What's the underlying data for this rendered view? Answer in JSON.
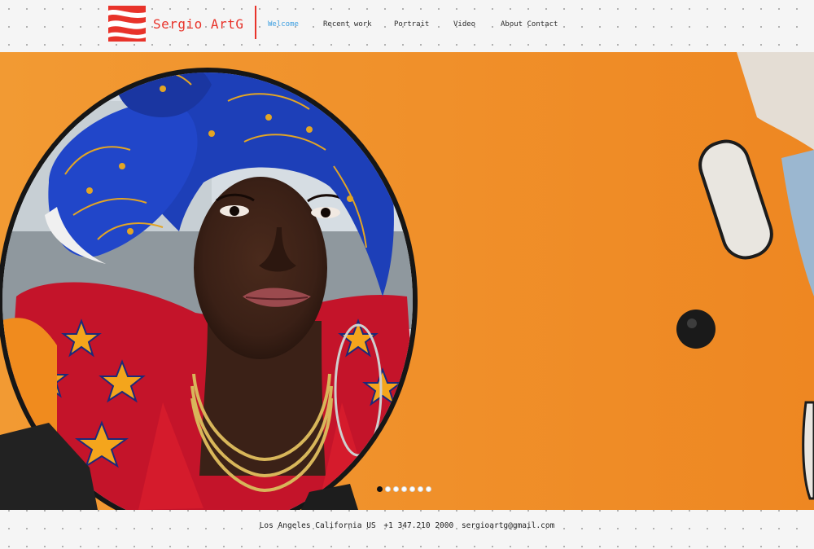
{
  "header": {
    "brand": "Sergio ArtG",
    "logo_icon": "red-white-wave-logo-icon",
    "nav": [
      {
        "label": "Welcome",
        "active": true
      },
      {
        "label": "Recent work",
        "active": false
      },
      {
        "label": "Portrait",
        "active": false
      },
      {
        "label": "Video",
        "active": false
      },
      {
        "label": "About Contact",
        "active": false
      }
    ]
  },
  "hero": {
    "slide_count": 7,
    "active_slide": 1
  },
  "footer": {
    "location": "Los Angeles California US",
    "phone": "+1 347.210 2000",
    "email": "sergioartg@gmail.com"
  },
  "colors": {
    "accent_red": "#e8332a",
    "nav_active": "#3c9ee0",
    "hero_orange": "#f08a22"
  }
}
